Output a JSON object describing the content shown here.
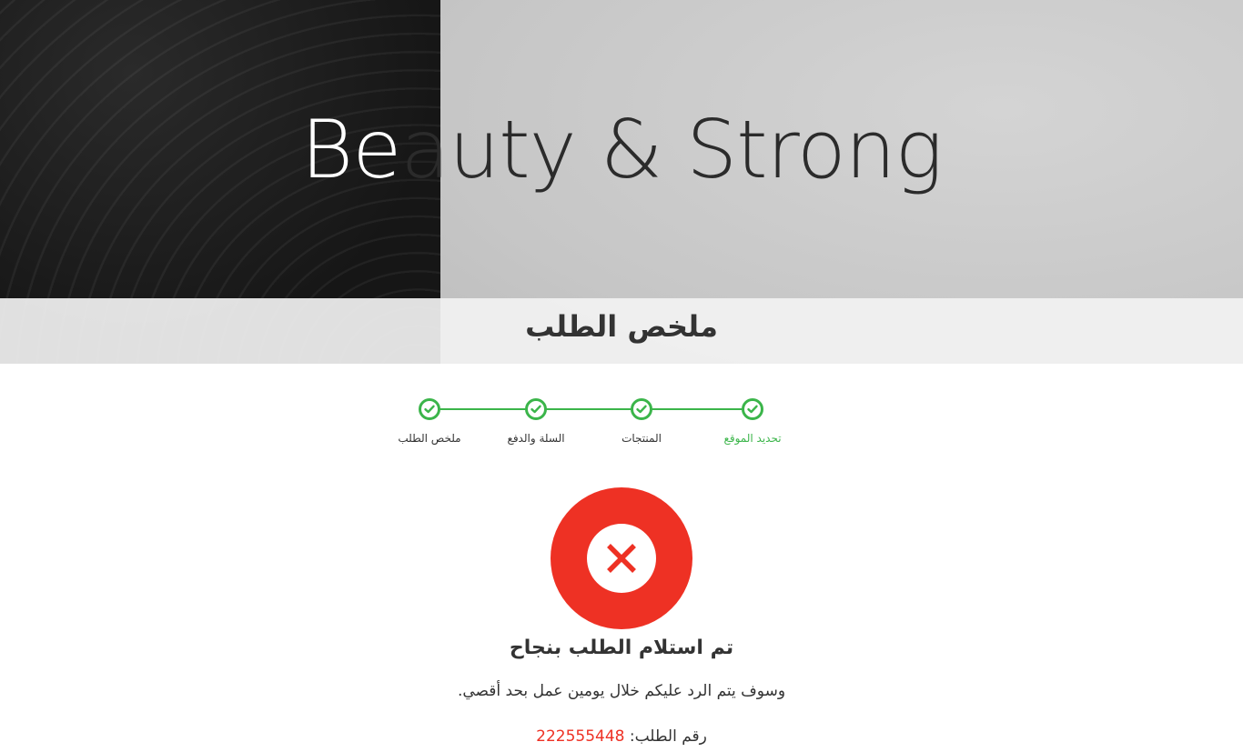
{
  "hero": {
    "title": "Beauty & Strong"
  },
  "summary": {
    "title": "ملخص الطلب"
  },
  "stepper": {
    "steps": [
      {
        "label": "تحديد الموقع",
        "active": true
      },
      {
        "label": "المنتجات",
        "active": false
      },
      {
        "label": "السلة والدفع",
        "active": false
      },
      {
        "label": "ملخص الطلب",
        "active": false
      }
    ],
    "accent_color": "#3bb54a"
  },
  "status": {
    "icon": "close-icon",
    "color": "#ee3124",
    "title": "تم استلام الطلب بنجاح",
    "message": "وسوف يتم الرد عليكم خلال يومين عمل بحد أقصي.",
    "order_label": "رقم الطلب:",
    "order_number": "222555448"
  }
}
